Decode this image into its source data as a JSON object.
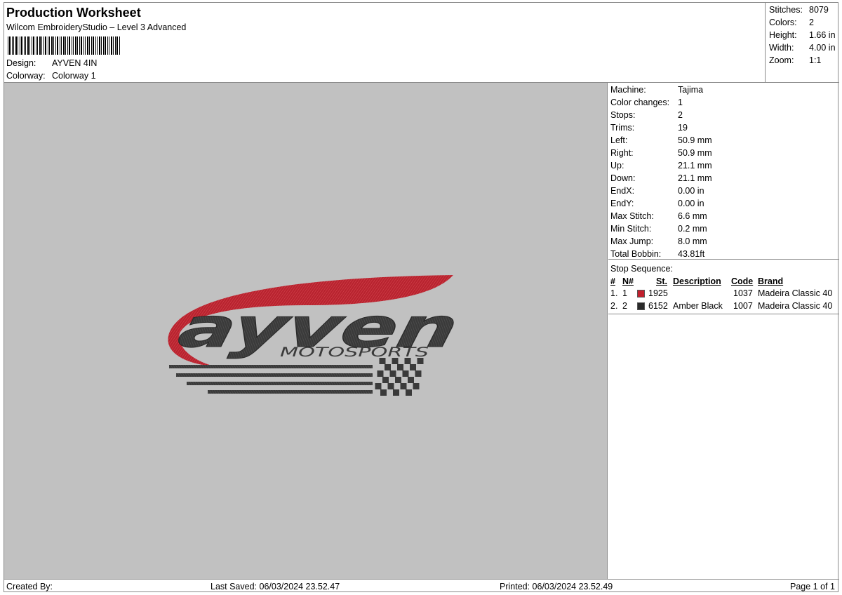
{
  "header": {
    "title": "Production Worksheet",
    "subtitle": "Wilcom EmbroideryStudio – Level 3 Advanced",
    "design_label": "Design:",
    "design_value": "AYVEN 4IN",
    "colorway_label": "Colorway:",
    "colorway_value": "Colorway 1"
  },
  "stats": [
    {
      "label": "Stitches:",
      "value": "8079"
    },
    {
      "label": "Colors:",
      "value": "2"
    },
    {
      "label": "Height:",
      "value": "1.66 in"
    },
    {
      "label": "Width:",
      "value": "4.00 in"
    },
    {
      "label": "Zoom:",
      "value": "1:1"
    }
  ],
  "machine_info": [
    {
      "label": "Machine:",
      "value": "Tajima"
    },
    {
      "label": "Color changes:",
      "value": "1"
    },
    {
      "label": "Stops:",
      "value": "2"
    },
    {
      "label": "Trims:",
      "value": "19"
    },
    {
      "label": "Left:",
      "value": "50.9 mm"
    },
    {
      "label": "Right:",
      "value": "50.9 mm"
    },
    {
      "label": "Up:",
      "value": "21.1 mm"
    },
    {
      "label": "Down:",
      "value": "21.1 mm"
    },
    {
      "label": "EndX:",
      "value": "0.00 in"
    },
    {
      "label": "EndY:",
      "value": "0.00 in"
    },
    {
      "label": "Max Stitch:",
      "value": "6.6 mm"
    },
    {
      "label": "Min Stitch:",
      "value": "0.2 mm"
    },
    {
      "label": "Max Jump:",
      "value": "8.0 mm"
    },
    {
      "label": "Total Bobbin:",
      "value": "43.81ft"
    }
  ],
  "stop_sequence": {
    "title": "Stop Sequence:",
    "columns": [
      "#",
      "N#",
      "St.",
      "Description",
      "Code",
      "Brand"
    ],
    "rows": [
      {
        "num": "1.",
        "n": "1",
        "color": "#c1202d",
        "stitches": "1925",
        "description": "",
        "code": "1037",
        "brand": "Madeira Classic 40"
      },
      {
        "num": "2.",
        "n": "2",
        "color": "#2a2a2a",
        "stitches": "6152",
        "description": "Amber Black",
        "code": "1007",
        "brand": "Madeira Classic 40"
      }
    ]
  },
  "design_art": {
    "wordmark": "ayven",
    "tagline": "MOTOSPORTS",
    "red": "#b8232f",
    "dark": "#3a3a3a"
  },
  "footer": {
    "created_by": "Created By:",
    "last_saved": "Last Saved: 06/03/2024 23.52.47",
    "printed": "Printed: 06/03/2024 23.52.49",
    "page": "Page 1 of 1"
  }
}
